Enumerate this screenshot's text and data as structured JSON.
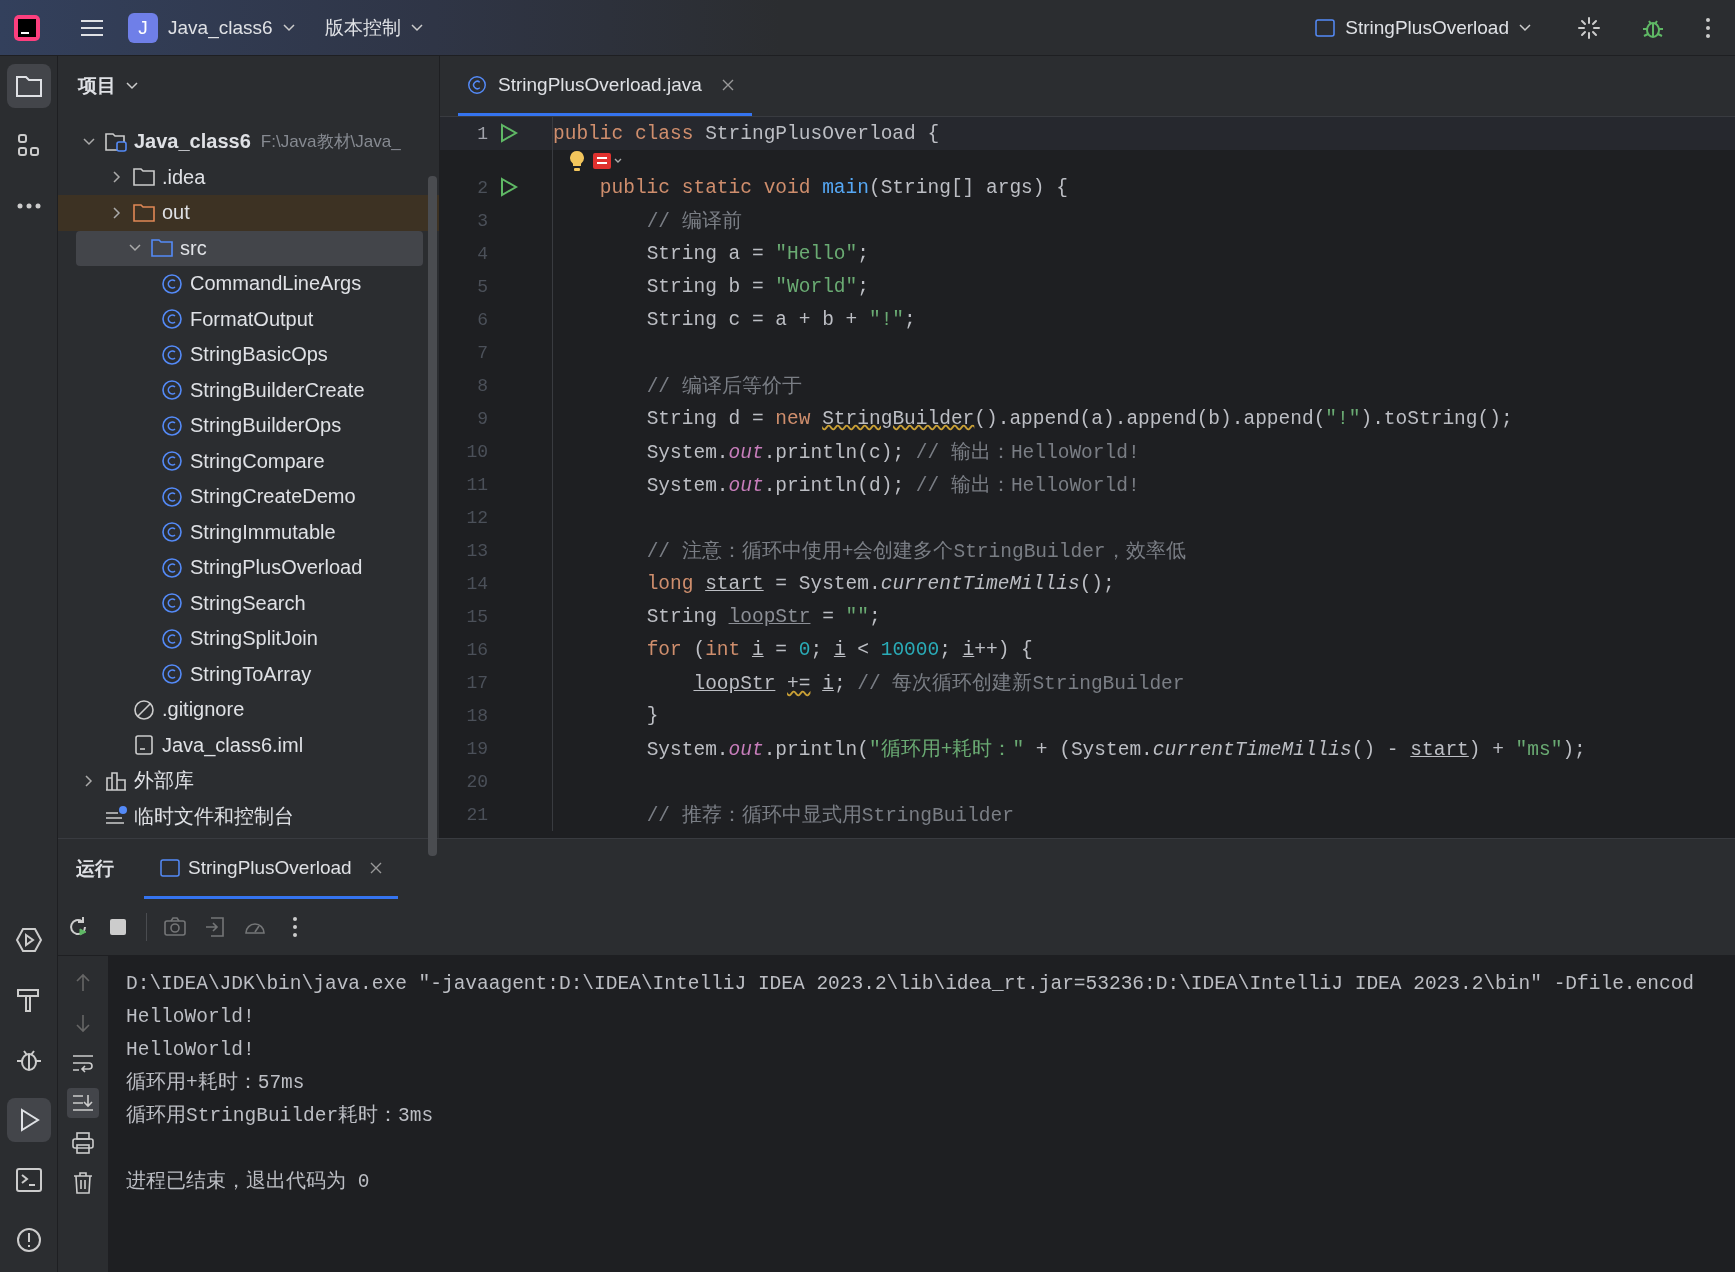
{
  "title_bar": {
    "project": {
      "badge": "J",
      "name": "Java_class6"
    },
    "vcs": "版本控制",
    "run_config": "StringPlusOverload"
  },
  "tool_strip": {
    "top": [
      {
        "kind": "project",
        "selected": true
      },
      {
        "kind": "structure",
        "selected": false
      },
      {
        "kind": "more",
        "selected": false
      }
    ],
    "bottom": [
      {
        "kind": "services",
        "selected": false
      },
      {
        "kind": "build",
        "selected": false
      },
      {
        "kind": "debug",
        "selected": false
      },
      {
        "kind": "run",
        "selected": true
      },
      {
        "kind": "terminal",
        "selected": false
      },
      {
        "kind": "problems",
        "selected": false
      }
    ]
  },
  "project_panel": {
    "title": "项目",
    "tree": [
      {
        "label": "Java_class6",
        "kind": "project",
        "hint": "F:\\Java教材\\Java_",
        "expanded": true,
        "selected": false,
        "children": [
          {
            "label": ".idea",
            "kind": "folder",
            "expanded": false,
            "selected": false
          },
          {
            "label": "out",
            "kind": "excluded",
            "expanded": false,
            "selected": false
          },
          {
            "label": "src",
            "kind": "source",
            "expanded": true,
            "selected": true,
            "children": [
              {
                "label": "CommandLineArgs",
                "kind": "class",
                "selected": false
              },
              {
                "label": "FormatOutput",
                "kind": "class",
                "selected": false
              },
              {
                "label": "StringBasicOps",
                "kind": "class",
                "selected": false
              },
              {
                "label": "StringBuilderCreate",
                "kind": "class",
                "selected": false
              },
              {
                "label": "StringBuilderOps",
                "kind": "class",
                "selected": false
              },
              {
                "label": "StringCompare",
                "kind": "class",
                "selected": false
              },
              {
                "label": "StringCreateDemo",
                "kind": "class",
                "selected": false
              },
              {
                "label": "StringImmutable",
                "kind": "class",
                "selected": false
              },
              {
                "label": "StringPlusOverload",
                "kind": "class",
                "selected": false
              },
              {
                "label": "StringSearch",
                "kind": "class",
                "selected": false
              },
              {
                "label": "StringSplitJoin",
                "kind": "class",
                "selected": false
              },
              {
                "label": "StringToArray",
                "kind": "class",
                "selected": false
              }
            ]
          },
          {
            "label": ".gitignore",
            "kind": "ignore",
            "selected": false
          },
          {
            "label": "Java_class6.iml",
            "kind": "file",
            "selected": false
          }
        ]
      },
      {
        "label": "外部库",
        "kind": "library",
        "expanded": false,
        "selected": false
      },
      {
        "label": "临时文件和控制台",
        "kind": "scratches",
        "selected": false
      }
    ]
  },
  "editor": {
    "tabs": [
      {
        "label": "StringPlusOverload.java",
        "selected": true
      }
    ],
    "lines": [
      {
        "number": "1",
        "run": true,
        "tokens": [
          {
            "kind": "kw",
            "text": "public class"
          },
          {
            "kind": "txt",
            "text": " StringPlusOverload {"
          }
        ]
      },
      {
        "number": "2",
        "run": true,
        "inlay": {
          "kind": "intention"
        },
        "tokens": [
          {
            "kind": "kw",
            "text": "    public static void"
          },
          {
            "kind": "fn",
            "text": " main"
          },
          {
            "kind": "txt",
            "text": "(String[] args) {"
          }
        ]
      },
      {
        "number": "3",
        "run": false,
        "tokens": [
          {
            "kind": "com",
            "text": "        // 编译前"
          }
        ]
      },
      {
        "number": "4",
        "run": false,
        "tokens": [
          {
            "kind": "txt",
            "text": "        String a = "
          },
          {
            "kind": "str",
            "text": "\"Hello\""
          },
          {
            "kind": "txt",
            "text": ";"
          }
        ]
      },
      {
        "number": "5",
        "run": false,
        "tokens": [
          {
            "kind": "txt",
            "text": "        String b = "
          },
          {
            "kind": "str",
            "text": "\"World\""
          },
          {
            "kind": "txt",
            "text": ";"
          }
        ]
      },
      {
        "number": "6",
        "run": false,
        "tokens": [
          {
            "kind": "txt",
            "text": "        String c = a + b + "
          },
          {
            "kind": "str",
            "text": "\"!\""
          },
          {
            "kind": "txt",
            "text": ";"
          }
        ]
      },
      {
        "number": "7",
        "run": false
      },
      {
        "number": "8",
        "run": false,
        "tokens": [
          {
            "kind": "com",
            "text": "        // 编译后等价于"
          }
        ]
      },
      {
        "number": "9",
        "run": false,
        "tokens": [
          {
            "kind": "txt",
            "text": "        String d = "
          },
          {
            "kind": "kw",
            "text": "new"
          },
          {
            "kind": "warn",
            "text": " StringBuilder"
          },
          {
            "kind": "txt",
            "text": "().append(a).append(b).append("
          },
          {
            "kind": "str",
            "text": "\"!\""
          },
          {
            "kind": "txt",
            "text": ").toString();"
          }
        ]
      },
      {
        "number": "10",
        "run": false,
        "tokens": [
          {
            "kind": "txt",
            "text": "        System."
          },
          {
            "kind": "fld",
            "text": "out"
          },
          {
            "kind": "txt",
            "text": ".println(c); "
          },
          {
            "kind": "com",
            "text": "// 输出：HelloWorld!"
          }
        ]
      },
      {
        "number": "11",
        "run": false,
        "tokens": [
          {
            "kind": "txt",
            "text": "        System."
          },
          {
            "kind": "fld",
            "text": "out"
          },
          {
            "kind": "txt",
            "text": ".println(d); "
          },
          {
            "kind": "com",
            "text": "// 输出：HelloWorld!"
          }
        ]
      },
      {
        "number": "12",
        "run": false
      },
      {
        "number": "13",
        "run": false,
        "tokens": [
          {
            "kind": "com",
            "text": "        // 注意：循环中使用+会创建多个StringBuilder，效率低"
          }
        ]
      },
      {
        "number": "14",
        "run": false,
        "tokens": [
          {
            "kind": "kw",
            "text": "        long"
          },
          {
            "kind": "var",
            "text": " start"
          },
          {
            "kind": "txt",
            "text": " = System."
          },
          {
            "kind": "ital",
            "text": "currentTimeMillis"
          },
          {
            "kind": "txt",
            "text": "();"
          }
        ]
      },
      {
        "number": "15",
        "run": false,
        "tokens": [
          {
            "kind": "txt",
            "text": "        String"
          },
          {
            "kind": "unused",
            "text": " loopStr"
          },
          {
            "kind": "txt",
            "text": " = "
          },
          {
            "kind": "str",
            "text": "\"\""
          },
          {
            "kind": "txt",
            "text": ";"
          }
        ]
      },
      {
        "number": "16",
        "run": false,
        "tokens": [
          {
            "kind": "kw",
            "text": "        for"
          },
          {
            "kind": "txt",
            "text": " ("
          },
          {
            "kind": "kw",
            "text": "int"
          },
          {
            "kind": "var",
            "text": " i"
          },
          {
            "kind": "txt",
            "text": " = "
          },
          {
            "kind": "num",
            "text": "0"
          },
          {
            "kind": "txt",
            "text": "; "
          },
          {
            "kind": "var",
            "text": "i"
          },
          {
            "kind": "txt",
            "text": " < "
          },
          {
            "kind": "num",
            "text": "10000"
          },
          {
            "kind": "txt",
            "text": "; "
          },
          {
            "kind": "var",
            "text": "i"
          },
          {
            "kind": "txt",
            "text": "++) {"
          }
        ]
      },
      {
        "number": "17",
        "run": false,
        "tokens": [
          {
            "kind": "var",
            "text": "            loopStr"
          },
          {
            "kind": "warn",
            "text": " +="
          },
          {
            "kind": "var",
            "text": " i"
          },
          {
            "kind": "txt",
            "text": "; "
          },
          {
            "kind": "com",
            "text": "// 每次循环创建新StringBuilder"
          }
        ]
      },
      {
        "number": "18",
        "run": false,
        "tokens": [
          {
            "kind": "txt",
            "text": "        }"
          }
        ]
      },
      {
        "number": "19",
        "run": false,
        "tokens": [
          {
            "kind": "txt",
            "text": "        System."
          },
          {
            "kind": "fld",
            "text": "out"
          },
          {
            "kind": "txt",
            "text": ".println("
          },
          {
            "kind": "str",
            "text": "\"循环用+耗时：\""
          },
          {
            "kind": "txt",
            "text": " + (System."
          },
          {
            "kind": "ital",
            "text": "currentTimeMillis"
          },
          {
            "kind": "txt",
            "text": "() - "
          },
          {
            "kind": "var",
            "text": "start"
          },
          {
            "kind": "txt",
            "text": ") + "
          },
          {
            "kind": "str",
            "text": "\"ms\""
          },
          {
            "kind": "txt",
            "text": ");"
          }
        ]
      },
      {
        "number": "20",
        "run": false
      },
      {
        "number": "21",
        "run": false,
        "tokens": [
          {
            "kind": "com",
            "text": "        // 推荐：循环中显式用StringBuilder"
          }
        ]
      }
    ]
  },
  "run_panel": {
    "title": "运行",
    "tabs": [
      {
        "label": "StringPlusOverload",
        "selected": true
      }
    ],
    "toolbar": [
      {
        "kind": "rerun",
        "disabled": false
      },
      {
        "kind": "stop",
        "disabled": false
      },
      {
        "kind": "camera",
        "disabled": true
      },
      {
        "kind": "exit",
        "disabled": true
      },
      {
        "kind": "gauge",
        "disabled": true
      },
      {
        "kind": "more",
        "disabled": false
      }
    ],
    "side": [
      {
        "kind": "up",
        "selected": false
      },
      {
        "kind": "down",
        "selected": false
      },
      {
        "kind": "wrap",
        "selected": false
      },
      {
        "kind": "scroll-end",
        "selected": true
      },
      {
        "kind": "print",
        "selected": false
      },
      {
        "kind": "delete",
        "selected": false
      }
    ],
    "output": [
      {
        "lines": [
          "D:\\IDEA\\JDK\\bin\\java.exe \"-javaagent:D:\\IDEA\\IntelliJ IDEA 2023.2\\lib\\idea_rt.jar=53236:D:\\IDEA\\IntelliJ IDEA 2023.2\\bin\" -Dfile.encod",
          "HelloWorld!",
          "HelloWorld!",
          "循环用+耗时：57ms",
          "循环用StringBuilder耗时：3ms"
        ]
      },
      {
        "lines": [
          "进程已结束，退出代码为 0"
        ]
      }
    ]
  }
}
